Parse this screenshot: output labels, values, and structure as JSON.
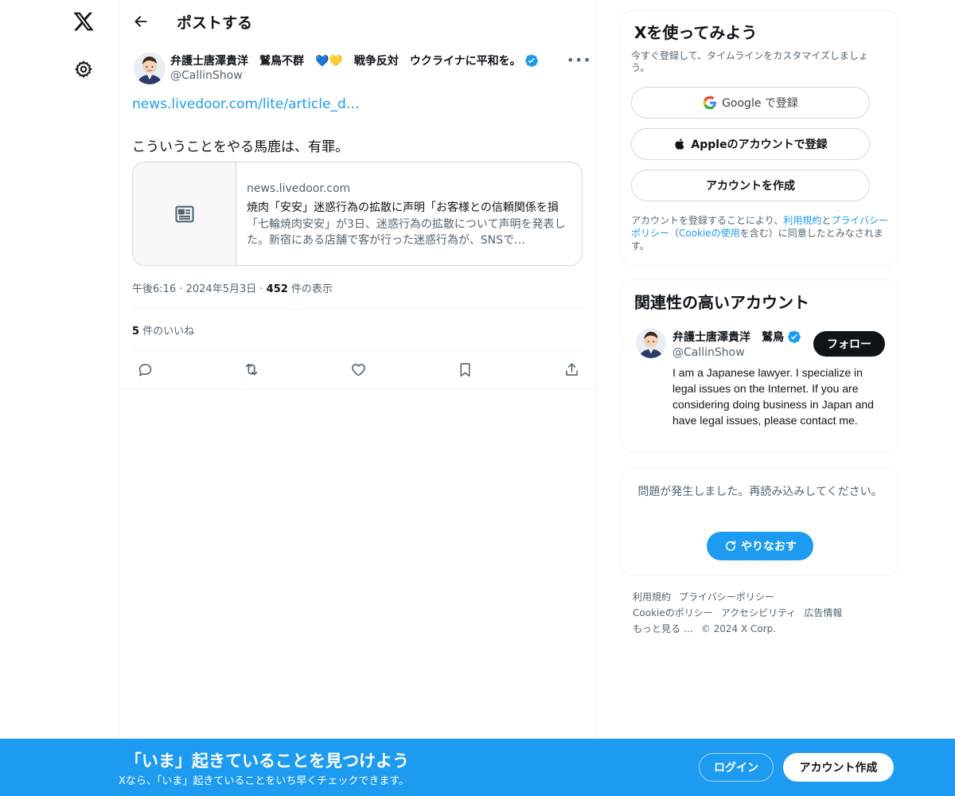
{
  "nav": {
    "logo_icon": "x-logo-icon",
    "settings_icon": "gear-icon"
  },
  "header": {
    "title": "ポストする",
    "back_icon": "arrow-left-icon"
  },
  "post": {
    "author_name": "弁護士唐澤貴洋　鷲鳥不群　💙💛　戦争反対　ウクライナに平和を。",
    "author_handle": "@CallinShow",
    "link_text": "news.livedoor.com/lite/article_d…",
    "text": "こういうことをやる馬鹿は、有罪。",
    "card": {
      "domain": "news.livedoor.com",
      "title": "焼肉「安安」迷惑行為の拡散に声明「お客様との信頼関係を損",
      "description": "「七輪焼肉安安」が3日、迷惑行為の拡散について声明を発表した。新宿にある店舗で客が行った迷惑行為が、SNSで…"
    },
    "time": "午後6:16",
    "date": "2024年5月3日",
    "views_count": "452",
    "views_label": " 件の表示",
    "likes_count": "5",
    "likes_label": " 件のいいね"
  },
  "signup_panel": {
    "title": "Xを使ってみよう",
    "subtitle": "今すぐ登録して、タイムラインをカスタマイズしましょう。",
    "google_brand": "Google",
    "google_suffix": " で登録",
    "apple_label": "Appleのアカウントで登録",
    "create_label": "アカウントを作成",
    "legal_prefix": "アカウントを登録することにより、",
    "legal_terms": "利用規約",
    "legal_and": "と",
    "legal_privacy": "プライバシーポリシー",
    "legal_mid": "（",
    "legal_cookie": "Cookieの使用",
    "legal_suffix": "を含む）に同意したとみなされます。"
  },
  "related_panel": {
    "title": "関連性の高いアカウント",
    "name": "弁護士唐澤貴洋　鷲鳥",
    "handle": "@CallinShow",
    "follow_label": "フォロー",
    "bio": "I am a Japanese lawyer. I specialize in legal issues on the Internet. If you are considering doing business in Japan and have legal issues, please contact me."
  },
  "error_panel": {
    "message": "問題が発生しました。再読み込みしてください。",
    "retry_label": "やりなおす"
  },
  "footer": {
    "terms": "利用規約",
    "privacy": "プライバシーポリシー",
    "cookie": "Cookieのポリシー",
    "accessibility": "アクセシビリティ",
    "ads": "広告情報",
    "more": "もっと見る …",
    "copyright": "© 2024 X Corp."
  },
  "bottom_bar": {
    "title": "「いま」起きていることを見つけよう",
    "subtitle": "Xなら、「いま」起きていることをいち早くチェックできます。",
    "login_label": "ログイン",
    "signup_label": "アカウント作成"
  },
  "colors": {
    "accent": "#1d9bf0",
    "text": "#0f1419",
    "muted": "#536471"
  }
}
